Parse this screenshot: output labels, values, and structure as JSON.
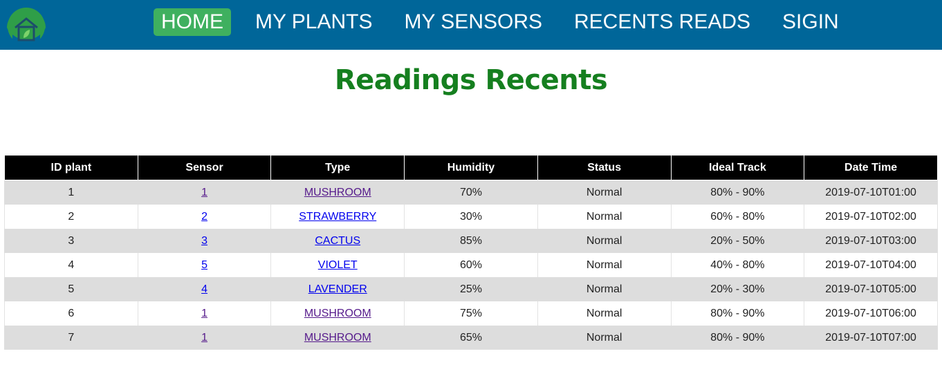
{
  "nav": {
    "logo_icon": "plant-house-logo-icon",
    "links": [
      {
        "label": "HOME",
        "active": true
      },
      {
        "label": "MY PLANTS",
        "active": false
      },
      {
        "label": "MY SENSORS",
        "active": false
      },
      {
        "label": "RECENTS READS",
        "active": false
      },
      {
        "label": "SIGIN",
        "active": false
      }
    ]
  },
  "title": "Readings Recents",
  "colors": {
    "navbar": "#006699",
    "active_tab": "#3fb05f",
    "title": "#157f1f",
    "table_header": "#000000",
    "row_stripe": "#dddddd"
  },
  "table": {
    "headers": [
      "ID plant",
      "Sensor",
      "Type",
      "Humidity",
      "Status",
      "Ideal Track",
      "Date Time"
    ],
    "rows": [
      {
        "id": "1",
        "sensor": "1",
        "type": "MUSHROOM",
        "humidity": "70%",
        "status": "Normal",
        "ideal": "80% - 90%",
        "datetime": "2019-07-10T01:00"
      },
      {
        "id": "2",
        "sensor": "2",
        "type": "STRAWBERRY",
        "humidity": "30%",
        "status": "Normal",
        "ideal": "60% - 80%",
        "datetime": "2019-07-10T02:00"
      },
      {
        "id": "3",
        "sensor": "3",
        "type": "CACTUS",
        "humidity": "85%",
        "status": "Normal",
        "ideal": "20% - 50%",
        "datetime": "2019-07-10T03:00"
      },
      {
        "id": "4",
        "sensor": "5",
        "type": "VIOLET",
        "humidity": "60%",
        "status": "Normal",
        "ideal": "40% - 80%",
        "datetime": "2019-07-10T04:00"
      },
      {
        "id": "5",
        "sensor": "4",
        "type": "LAVENDER",
        "humidity": "25%",
        "status": "Normal",
        "ideal": "20% - 30%",
        "datetime": "2019-07-10T05:00"
      },
      {
        "id": "6",
        "sensor": "1",
        "type": "MUSHROOM",
        "humidity": "75%",
        "status": "Normal",
        "ideal": "80% - 90%",
        "datetime": "2019-07-10T06:00"
      },
      {
        "id": "7",
        "sensor": "1",
        "type": "MUSHROOM",
        "humidity": "65%",
        "status": "Normal",
        "ideal": "80% - 90%",
        "datetime": "2019-07-10T07:00"
      }
    ]
  }
}
